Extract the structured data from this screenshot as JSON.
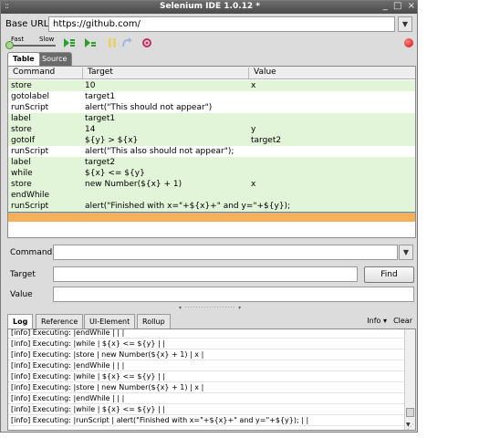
{
  "window": {
    "title": "Selenium IDE 1.0.12 *",
    "grip": "::",
    "controls": {
      "minimize": "_",
      "maximize": "□",
      "close": "×"
    }
  },
  "base_url": {
    "label": "Base URL",
    "value": "https://github.com/"
  },
  "toolbar": {
    "fast_label": "Fast",
    "slow_label": "Slow"
  },
  "editor_tabs": [
    {
      "label": "Table",
      "active": true
    },
    {
      "label": "Source",
      "active": false
    }
  ],
  "grid": {
    "columns": [
      "Command",
      "Target",
      "Value"
    ],
    "rows": [
      {
        "command": "store",
        "target": "10",
        "value": "x"
      },
      {
        "command": "gotolabel",
        "target": "target1",
        "value": ""
      },
      {
        "command": "runScript",
        "target": "alert(\"This should not appear\")",
        "value": ""
      },
      {
        "command": "label",
        "target": "target1",
        "value": ""
      },
      {
        "command": "store",
        "target": "14",
        "value": "y"
      },
      {
        "command": "gotoIf",
        "target": "${y} > ${x}",
        "value": "target2"
      },
      {
        "command": "runScript",
        "target": "alert(\"This also should not appear\");",
        "value": ""
      },
      {
        "command": "label",
        "target": "target2",
        "value": ""
      },
      {
        "command": "while",
        "target": "${x} <= ${y}",
        "value": ""
      },
      {
        "command": "store",
        "target": "new Number(${x} + 1)",
        "value": "x"
      },
      {
        "command": "endWhile",
        "target": "",
        "value": ""
      },
      {
        "command": "runScript",
        "target": "alert(\"Finished with x=\"+${x}+\" and y=\"+${y});",
        "value": ""
      }
    ]
  },
  "form": {
    "command_label": "Command",
    "target_label": "Target",
    "value_label": "Value",
    "find_label": "Find",
    "command_value": "",
    "target_value": "",
    "value_value": ""
  },
  "log_tabs": [
    {
      "label": "Log",
      "active": true
    },
    {
      "label": "Reference",
      "active": false
    },
    {
      "label": "UI-Element",
      "active": false
    },
    {
      "label": "Rollup",
      "active": false
    }
  ],
  "log_controls": {
    "info_label": "Info ▾",
    "clear_label": "Clear"
  },
  "log_lines": [
    "[info] Executing: |endWhile | | |",
    "[info] Executing: |while | ${x} <= ${y} | |",
    "[info] Executing: |store | new Number(${x} + 1) | x |",
    "[info] Executing: |endWhile | | |",
    "[info] Executing: |while | ${x} <= ${y} | |",
    "[info] Executing: |store | new Number(${x} + 1) | x |",
    "[info] Executing: |endWhile | | |",
    "[info] Executing: |while | ${x} <= ${y} | |",
    "[info] Executing: |runScript | alert(\"Finished with x=\"+${x}+\" and y=\"+${y}); | |"
  ],
  "colors": {
    "row_green": "#e3f5d8",
    "selected_row": "#f8b058",
    "titlebar": "#5a5a5a"
  }
}
